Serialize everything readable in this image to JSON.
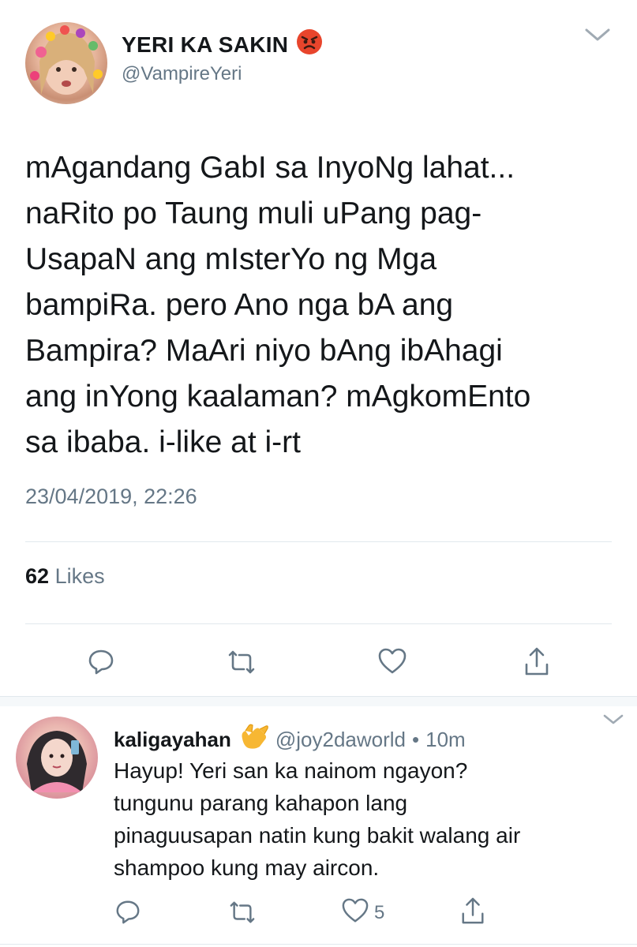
{
  "tweet": {
    "display_name": "YERI KA SAKIN",
    "name_emoji": "angry-face",
    "handle": "@VampireYeri",
    "text_lines": [
      "mAgandang GabI sa InyoNg lahat...",
      "naRito po Taung muli uPang pag-",
      "UsapaN ang mIsterYo ng Mga",
      "bampiRa. pero Ano nga bA ang",
      "Bampira? MaAri niyo bAng ibAhagi",
      "ang inYong kaalaman? mAgkomEnto",
      "sa ibaba. i-like at i-rt"
    ],
    "timestamp": "23/04/2019, 22:26",
    "likes_count": "62",
    "likes_label": "Likes"
  },
  "reply": {
    "display_name": "kaligayahan",
    "name_emoji": "call-me-hand",
    "handle": "@joy2daworld",
    "separator": "•",
    "time": "10m",
    "text_lines": [
      "Hayup! Yeri san ka nainom ngayon?",
      "tungunu parang kahapon lang",
      "pinaguusapan natin kung bakit walang air",
      "shampoo kung may aircon."
    ],
    "like_count": "5"
  },
  "colors": {
    "text": "#14171a",
    "muted": "#657786",
    "divider": "#e1e8ed",
    "icon": "#657786"
  }
}
